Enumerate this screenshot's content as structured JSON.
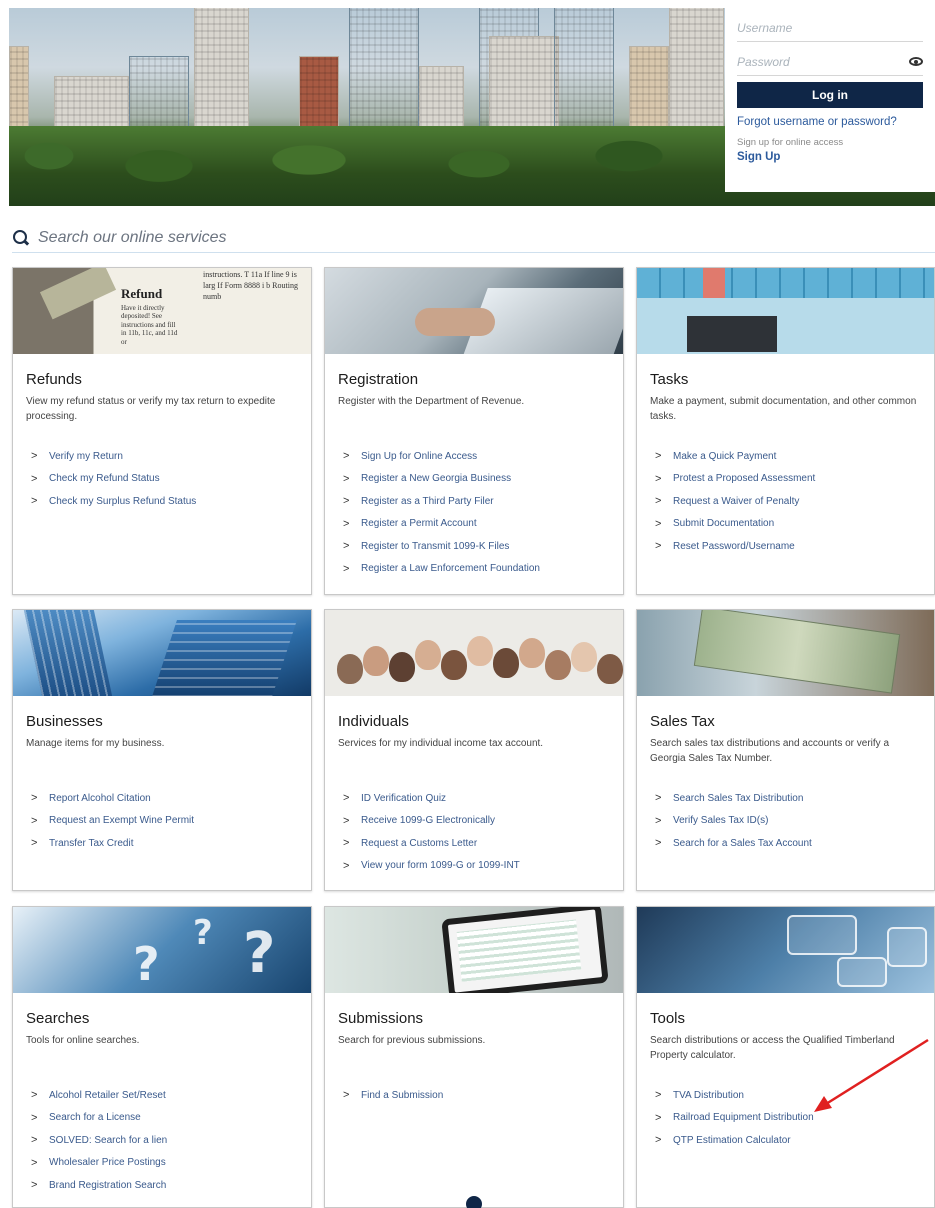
{
  "login": {
    "username_placeholder": "Username",
    "password_placeholder": "Password",
    "login_button": "Log in",
    "forgot_link": "Forgot username or password?",
    "signup_label": "Sign up for online access",
    "signup_link": "Sign Up"
  },
  "search": {
    "placeholder": "Search our online services"
  },
  "cards": [
    {
      "title": "Refunds",
      "description": "View my refund status or verify my tax return to expedite processing.",
      "links": [
        "Verify my Return",
        "Check my Refund Status",
        "Check my Surplus Refund Status"
      ]
    },
    {
      "title": "Registration",
      "description": "Register with the Department of Revenue.",
      "links": [
        "Sign Up for Online Access",
        "Register a New Georgia Business",
        "Register as a Third Party Filer",
        "Register a Permit Account",
        "Register to Transmit 1099-K Files",
        "Register a Law Enforcement Foundation"
      ]
    },
    {
      "title": "Tasks",
      "description": "Make a payment, submit documentation, and other common tasks.",
      "links": [
        "Make a Quick Payment",
        "Protest a Proposed Assessment",
        "Request a Waiver of Penalty",
        "Submit Documentation",
        "Reset Password/Username"
      ]
    },
    {
      "title": "Businesses",
      "description": "Manage items for my business.",
      "links": [
        "Report Alcohol Citation",
        "Request an Exempt Wine Permit",
        "Transfer Tax Credit"
      ]
    },
    {
      "title": "Individuals",
      "description": "Services for my individual income tax account.",
      "links": [
        "ID Verification Quiz",
        "Receive 1099-G Electronically",
        "Request a Customs Letter",
        "View your form 1099-G or 1099-INT"
      ]
    },
    {
      "title": "Sales Tax",
      "description": "Search sales tax distributions and accounts or verify a Georgia Sales Tax Number.",
      "links": [
        "Search Sales Tax Distribution",
        "Verify Sales Tax ID(s)",
        "Search for a Sales Tax Account"
      ]
    },
    {
      "title": "Searches",
      "description": "Tools for online searches.",
      "links": [
        "Alcohol Retailer Set/Reset",
        "Search for a License",
        "SOLVED: Search for a lien",
        "Wholesaler Price Postings",
        "Brand Registration Search"
      ]
    },
    {
      "title": "Submissions",
      "description": "Search for previous submissions.",
      "links": [
        "Find a Submission"
      ]
    },
    {
      "title": "Tools",
      "description": "Search distributions or access the Qualified Timberland Property calculator.",
      "links": [
        "TVA Distribution",
        "Railroad Equipment Distribution",
        "QTP Estimation Calculator"
      ]
    }
  ],
  "refund_image_text": {
    "heading": "Refund",
    "body": "Have it directly deposited! See instructions and fill in 11b, 11c, and 11d or",
    "side": "instructions. T 11a If line 9 is larg If Form 8888 i b Routing numb"
  },
  "colors": {
    "primary_dark": "#0f2647",
    "link_blue": "#3a5a8c",
    "annotation_arrow": "#e02020"
  },
  "icons": {
    "search": "magnifier",
    "password_visibility": "eye",
    "link_bullet": "chevron-right"
  }
}
